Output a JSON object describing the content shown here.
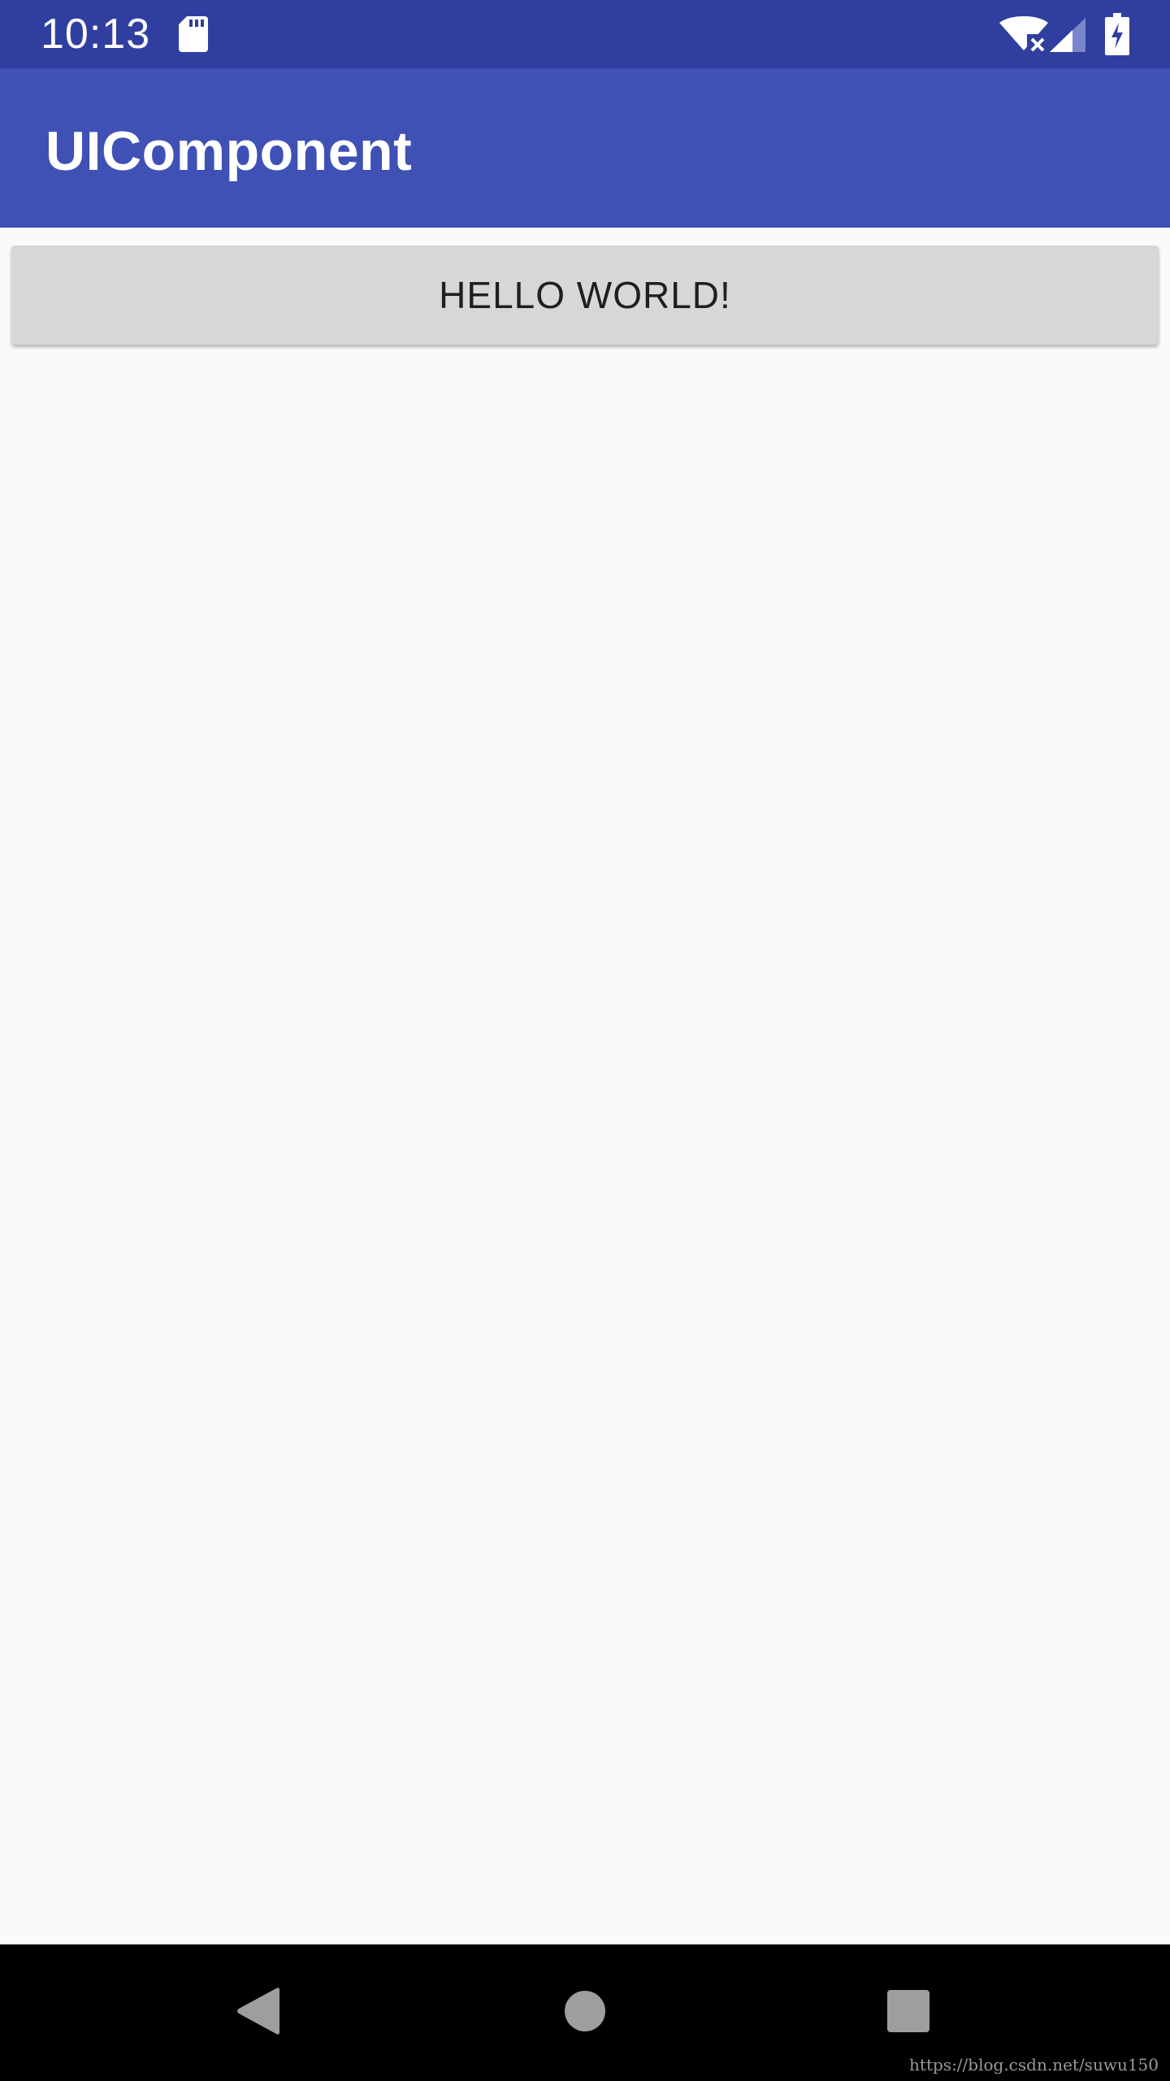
{
  "status_bar": {
    "time": "10:13",
    "icons": [
      "sd-card-icon",
      "wifi-off-icon",
      "cell-signal-icon",
      "battery-charging-icon"
    ],
    "background": "#303f9f"
  },
  "app_bar": {
    "title": "UIComponent",
    "background": "#3f51b5"
  },
  "content": {
    "button_label": "HELLO WORLD!",
    "button_color": "#d6d7d7"
  },
  "nav_bar": {
    "icons": [
      "back-icon",
      "home-icon",
      "recents-icon"
    ]
  },
  "watermark": "https://blog.csdn.net/suwu150"
}
